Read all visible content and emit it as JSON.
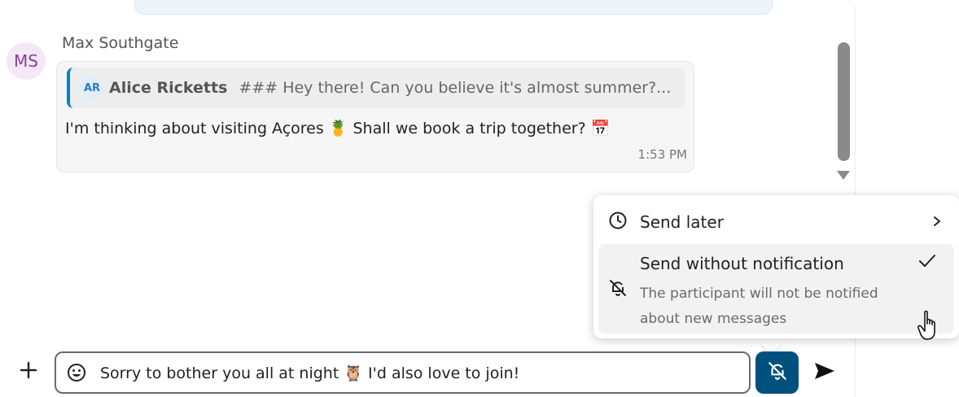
{
  "message": {
    "author": "Max Southgate",
    "avatar_initials": "MS",
    "quote": {
      "avatar_initials": "AR",
      "author": "Alice Ricketts",
      "text": "### Hey there! Can you believe it's almost summer?..."
    },
    "text": "I'm thinking about visiting Açores 🍍 Shall we book a trip together? 📅",
    "time": "1:53 PM"
  },
  "send_menu": {
    "send_later": {
      "label": "Send later",
      "icon": "clock-icon"
    },
    "send_without_notification": {
      "label": "Send without notification",
      "description": "The participant will not be notified about new messages",
      "icon": "bell-off-icon",
      "checked": true
    }
  },
  "composer": {
    "value": "Sorry to bother you all at night 🦉 I'd also love to join!"
  },
  "colors": {
    "accent": "#00507e",
    "quote_border": "#0082c9",
    "avatar_text": "#8b3e9b"
  }
}
